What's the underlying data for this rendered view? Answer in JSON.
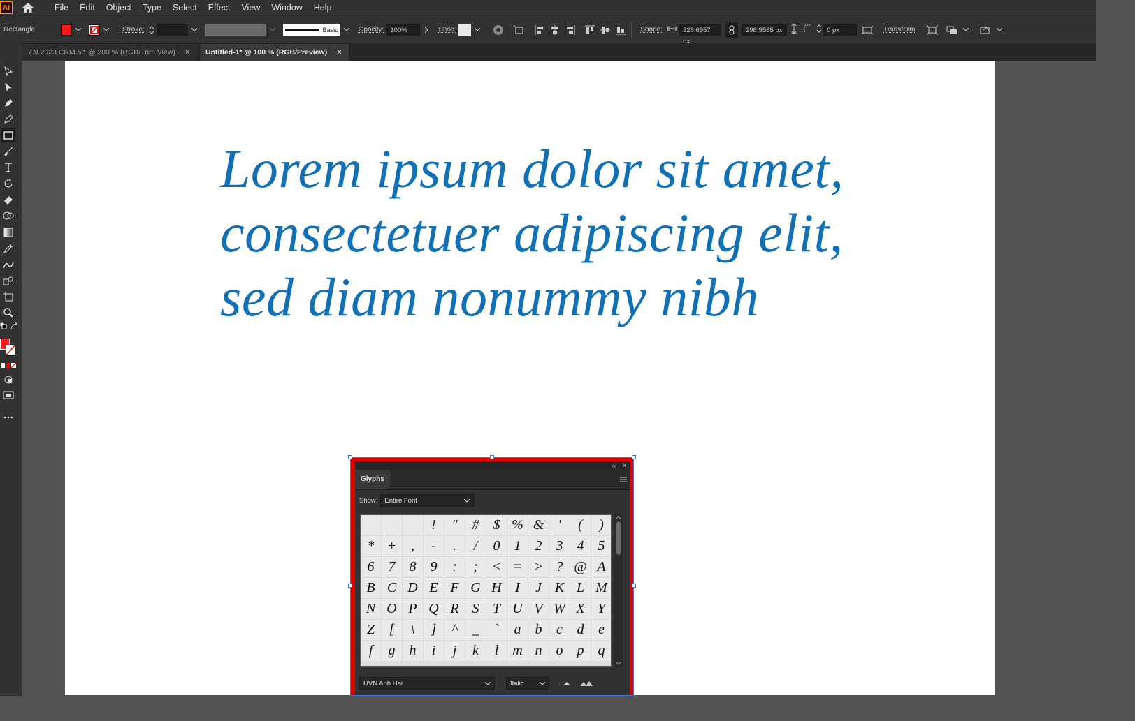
{
  "app": {
    "logo_text": "Ai"
  },
  "menu": [
    "File",
    "Edit",
    "Object",
    "Type",
    "Select",
    "Effect",
    "View",
    "Window",
    "Help"
  ],
  "control_bar": {
    "tool_name": "Rectangle",
    "fill_color": "#ff0000",
    "stroke_label": "Stroke:",
    "stroke_style": "Basic",
    "opacity_label": "Opacity:",
    "opacity_value": "100%",
    "style_label": "Style:",
    "shape_label": "Shape:",
    "width_value": "328.6957 px",
    "height_value": "298.9565 px",
    "corner_value": "0 px",
    "transform_label": "Transform"
  },
  "tabs": [
    {
      "label": "7.9.2023 CRM.ai* @ 200 % (RGB/Trim View)",
      "active": false
    },
    {
      "label": "Untitled-1* @ 100 % (RGB/Preview)",
      "active": true
    }
  ],
  "tools": [
    "selection-tool",
    "direct-selection-tool",
    "pen-tool",
    "curvature-tool",
    "rectangle-tool",
    "paintbrush-tool",
    "type-tool",
    "rotate-tool",
    "eraser-tool",
    "shape-builder-tool",
    "gradient-tool",
    "eyedropper-tool",
    "blend-tool",
    "symbol-sprayer-tool",
    "artboard-tool",
    "zoom-tool"
  ],
  "artboard": {
    "text_color": "#1270b4",
    "lines": [
      "Lorem ipsum dolor sit amet,",
      "consectetuer adipiscing elit,",
      "sed diam nonummy nibh"
    ]
  },
  "glyphs_panel": {
    "title": "Glyphs",
    "show_label": "Show:",
    "show_value": "Entire Font",
    "glyphs": [
      "",
      "",
      "",
      "!",
      "\"",
      "#",
      "$",
      "%",
      "&",
      "'",
      "(",
      ")",
      "*",
      "+",
      ",",
      "-",
      ".",
      "/",
      "0",
      "1",
      "2",
      "3",
      "4",
      "5",
      "6",
      "7",
      "8",
      "9",
      ":",
      ";",
      "<",
      "=",
      ">",
      "?",
      "@",
      "A",
      "B",
      "C",
      "D",
      "E",
      "F",
      "G",
      "H",
      "I",
      "J",
      "K",
      "L",
      "M",
      "N",
      "O",
      "P",
      "Q",
      "R",
      "S",
      "T",
      "U",
      "V",
      "W",
      "X",
      "Y",
      "Z",
      "[",
      "\\",
      "]",
      "^",
      "_",
      "`",
      "a",
      "b",
      "c",
      "d",
      "e",
      "f",
      "g",
      "h",
      "i",
      "j",
      "k",
      "l",
      "m",
      "n",
      "o",
      "p",
      "q"
    ],
    "font_name": "UVN Anh Hai",
    "font_style": "Italic"
  },
  "colors": {
    "accent_red": "#e00000",
    "selection_blue": "#3d7ad6"
  }
}
